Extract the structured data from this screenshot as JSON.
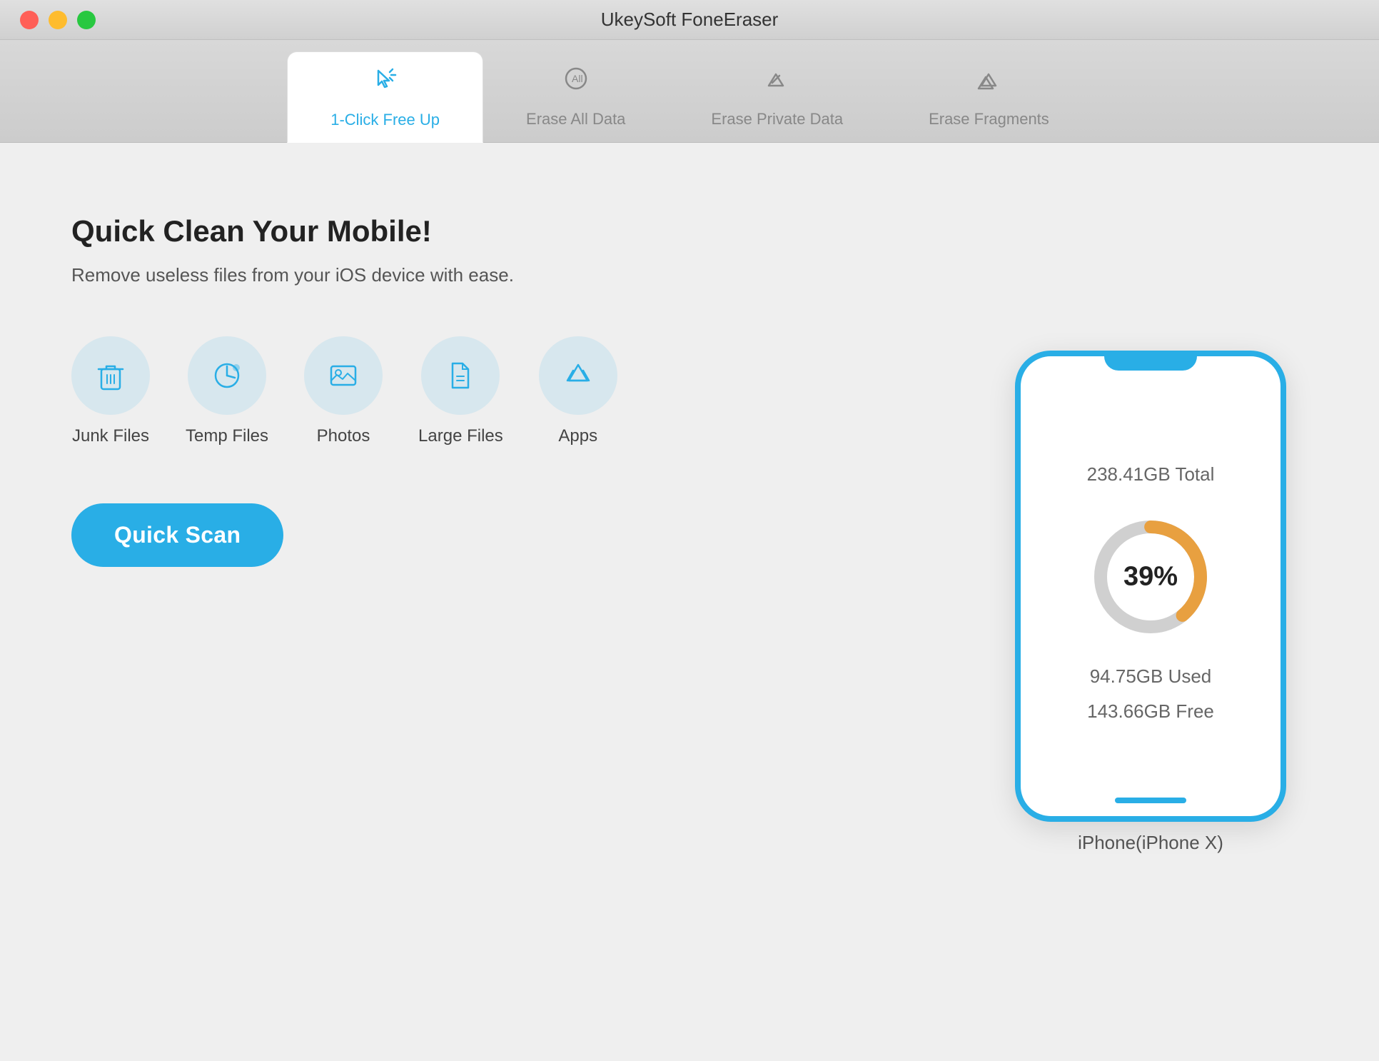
{
  "app": {
    "title": "UkeySoft FoneEraser"
  },
  "window_controls": {
    "close": "close",
    "minimize": "minimize",
    "maximize": "maximize"
  },
  "tabs": [
    {
      "id": "1click",
      "label": "1-Click Free Up",
      "active": true
    },
    {
      "id": "eraseall",
      "label": "Erase All Data",
      "active": false
    },
    {
      "id": "eraseprivate",
      "label": "Erase Private Data",
      "active": false
    },
    {
      "id": "erasefragments",
      "label": "Erase Fragments",
      "active": false
    }
  ],
  "main": {
    "headline": "Quick Clean Your Mobile!",
    "subtext": "Remove useless files from your iOS device with ease.",
    "features": [
      {
        "id": "junk",
        "label": "Junk Files",
        "icon": "🗑"
      },
      {
        "id": "temp",
        "label": "Temp Files",
        "icon": "🕐"
      },
      {
        "id": "photos",
        "label": "Photos",
        "icon": "🖼"
      },
      {
        "id": "large",
        "label": "Large Files",
        "icon": "📄"
      },
      {
        "id": "apps",
        "label": "Apps",
        "icon": "⬡"
      }
    ],
    "quick_scan_label": "Quick Scan"
  },
  "device": {
    "total": "238.41GB Total",
    "percent": "39%",
    "used": "94.75GB Used",
    "free": "143.66GB Free",
    "name": "iPhone(iPhone X)",
    "used_ratio": 0.39
  }
}
